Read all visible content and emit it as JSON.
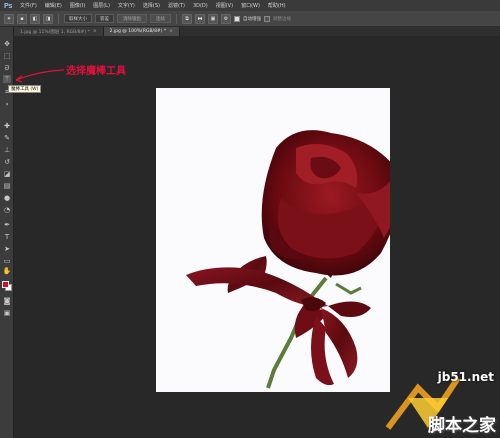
{
  "app": {
    "logo": "Ps"
  },
  "menu": [
    "文件(F)",
    "编辑(E)",
    "图像(I)",
    "图层(L)",
    "文字(Y)",
    "选择(S)",
    "滤镜(T)",
    "3D(D)",
    "视图(V)",
    "窗口(W)",
    "帮助(H)"
  ],
  "options": {
    "sample_size": "取样大小",
    "tolerance": "容差",
    "anti_alias": "消除锯齿",
    "contiguous": "连续",
    "sample_all_layers": "对所有图层取样",
    "auto_enhance": "自动增强",
    "refine_edge": "调整边缘"
  },
  "tabs": [
    {
      "label": "1.jpg @ 11%(图层 1, RGB/8#) *",
      "close": "×"
    },
    {
      "label": "2.jpg @ 100%(RGB/8#) *",
      "close": "×"
    }
  ],
  "tooltip": {
    "text": "魔棒工具 (W)"
  },
  "annotation": {
    "text": "选择魔棒工具",
    "color": "#e0103c"
  },
  "colors": {
    "foreground": "#c8102e",
    "background": "#ffffff",
    "canvas": "#fbfbfd"
  },
  "watermark": {
    "url": "jb51.net",
    "name": "脚本之家"
  },
  "icons": [
    "move-icon",
    "marquee-icon",
    "lasso-icon",
    "magic-wand-icon",
    "crop-icon",
    "eyedropper-icon",
    "healing-brush-icon",
    "brush-icon",
    "clone-stamp-icon",
    "history-brush-icon",
    "eraser-icon",
    "gradient-icon",
    "blur-icon",
    "dodge-icon",
    "pen-icon",
    "type-icon",
    "path-selection-icon",
    "shape-icon",
    "hand-icon",
    "zoom-icon"
  ]
}
